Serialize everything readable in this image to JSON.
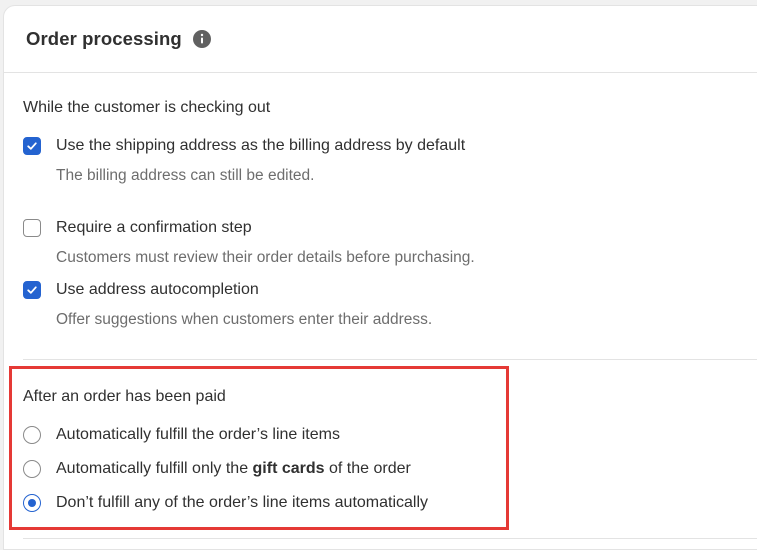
{
  "card": {
    "title": "Order processing",
    "info_icon": "info-circle-icon"
  },
  "checkout": {
    "label": "While the customer is checking out",
    "options": [
      {
        "label": "Use the shipping address as the billing address by default",
        "help": "The billing address can still be edited.",
        "checked": true
      },
      {
        "label": "Require a confirmation step",
        "help": "Customers must review their order details before purchasing.",
        "checked": false
      },
      {
        "label": "Use address autocompletion",
        "help": "Offer suggestions when customers enter their address.",
        "checked": true
      }
    ]
  },
  "paid": {
    "label": "After an order has been paid",
    "options": [
      {
        "label": "Automatically fulfill the order’s line items",
        "selected": false
      },
      {
        "label_prefix": "Automatically fulfill only the ",
        "label_bold": "gift cards",
        "label_suffix": " of the order",
        "selected": false
      },
      {
        "label": "Don’t fulfill any of the order’s line items automatically",
        "selected": true
      }
    ]
  },
  "colors": {
    "accent": "#2463d0",
    "highlight_border": "#e53935"
  }
}
